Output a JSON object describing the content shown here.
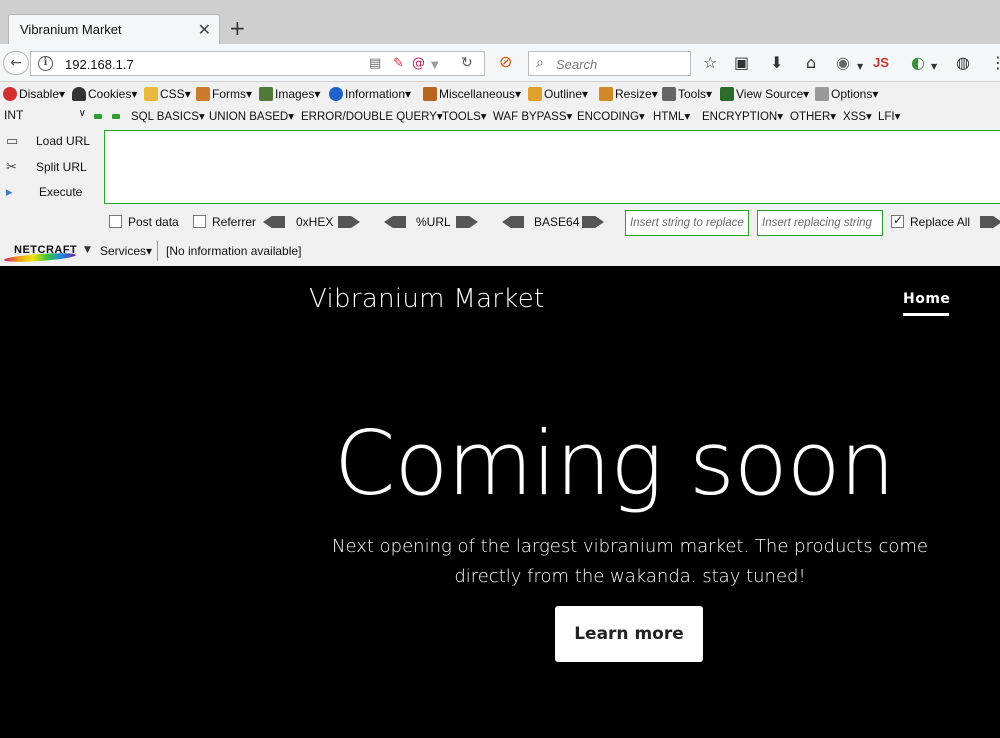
{
  "browser": {
    "tab_title": "Vibranium Market",
    "tab_close": "✕",
    "new_tab": "+",
    "url": "192.168.1.7",
    "search_placeholder": "Search",
    "js_label": "JS"
  },
  "hackbar": {
    "menu1": [
      "Disable",
      "Cookies",
      "CSS",
      "Forms",
      "Images",
      "Information",
      "Miscellaneous",
      "Outline",
      "Resize",
      "Tools",
      "View Source",
      "Options"
    ],
    "int_select": "INT",
    "menu2": [
      "SQL BASICS",
      "UNION BASED",
      "ERROR/DOUBLE QUERY",
      "TOOLS",
      "WAF BYPASS",
      "ENCODING",
      "HTML",
      "ENCRYPTION",
      "OTHER",
      "XSS",
      "LFI"
    ],
    "load_url": "Load URL",
    "split_url": "Split URL",
    "execute": "Execute",
    "post_data": "Post data",
    "referrer": "Referrer",
    "hex": "0xHEX",
    "url_enc": "%URL",
    "base64": "BASE64",
    "insert_replace": "Insert string to replace",
    "insert_replacing": "Insert replacing string",
    "replace_all": "Replace All"
  },
  "netcraft": {
    "logo_text": "NETCRAFT",
    "services": "Services",
    "info": "[No information available]"
  },
  "site": {
    "brand": "Vibranium Market",
    "nav_home": "Home",
    "hero_title": "Coming soon",
    "hero_sub": "Next opening of the largest vibranium market. The products come directly from the wakanda. stay tuned!",
    "button": "Learn more"
  },
  "colors": {
    "accent_green": "#2aa52a",
    "site_bg": "#000000"
  }
}
